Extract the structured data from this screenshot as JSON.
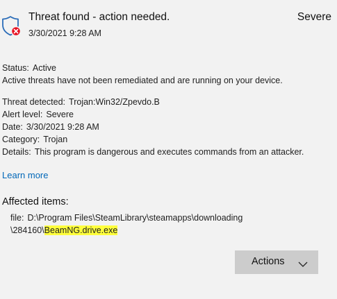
{
  "notification": {
    "title": "Threat found - action needed.",
    "timestamp": "3/30/2021 9:28 AM",
    "severity": "Severe",
    "icon": "shield-error-icon"
  },
  "status": {
    "label": "Status:",
    "value": "Active",
    "description": "Active threats have not been remediated and are running on your device."
  },
  "details": {
    "threat_label": "Threat detected:",
    "threat_value": "Trojan:Win32/Zpevdo.B",
    "alert_label": "Alert level:",
    "alert_value": "Severe",
    "date_label": "Date:",
    "date_value": "3/30/2021 9:28 AM",
    "category_label": "Category:",
    "category_value": "Trojan",
    "details_label": "Details:",
    "details_value": "This program is dangerous and executes commands from an attacker."
  },
  "learn_more": "Learn more",
  "affected": {
    "heading": "Affected items:",
    "prefix": "file:",
    "path_line1": "D:\\Program Files\\SteamLibrary\\steamapps\\downloading",
    "path_line2": "\\284160\\",
    "filename": "BeamNG.drive.exe"
  },
  "actions_button": "Actions",
  "colors": {
    "background": "#f2f2f2",
    "link": "#0067b8",
    "shield": "#2b6cb8",
    "error_badge": "#e81123",
    "highlight": "#ffff3c",
    "button": "#cccccc"
  }
}
